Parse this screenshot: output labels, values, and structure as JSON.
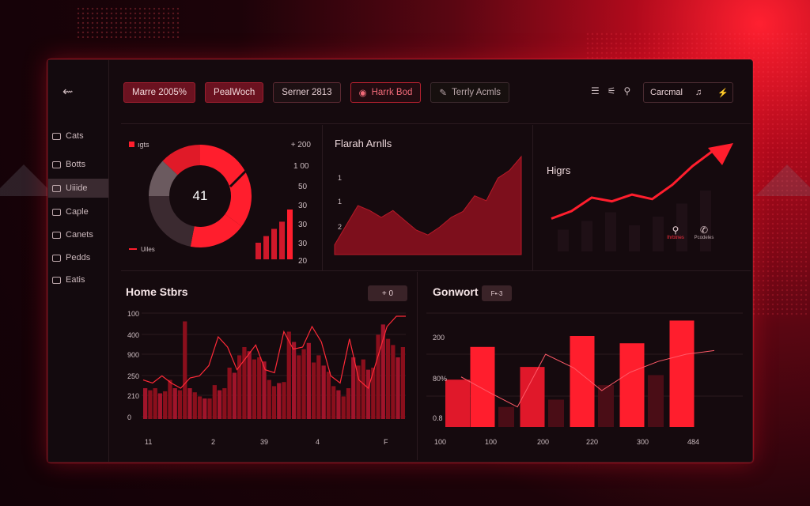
{
  "sidebar": {
    "back_icon": "arrow-left-icon",
    "items": [
      {
        "label": "Cats",
        "icon": "chart-icon"
      },
      {
        "label": "Botts",
        "icon": "wallet-icon"
      },
      {
        "label": "Uiiide",
        "icon": "grid-icon"
      },
      {
        "label": "Caple",
        "icon": "card-icon"
      },
      {
        "label": "Canets",
        "icon": "users-icon"
      },
      {
        "label": "Pedds",
        "icon": "folder-icon"
      },
      {
        "label": "Eatis",
        "icon": "list-icon"
      }
    ]
  },
  "topbar": {
    "buttons": [
      {
        "label": "Marre 2005%",
        "style": "red"
      },
      {
        "label": "PealWoch",
        "style": "red"
      },
      {
        "label": "Serner 2813",
        "style": "dark"
      },
      {
        "label": "Harrk Bod",
        "style": "outline",
        "icon": "eye-icon"
      },
      {
        "label": "Terrly Acmls",
        "style": "ghost",
        "icon": "pen-icon"
      }
    ],
    "tools": [
      "menu-icon",
      "filter-icon",
      "search-icon"
    ],
    "account": {
      "label": "Carcmal",
      "icon1": "bell-icon",
      "icon2": "bolt-icon"
    }
  },
  "colors": {
    "accent": "#ff1e2d",
    "dark_red": "#8a0f1c",
    "gray": "#6b5a5f",
    "bg": "#150a0e"
  },
  "panels": {
    "donut": {
      "legend_top": "ıgts",
      "legend_bottom": "Uiles",
      "center_value": "41",
      "top_right": "+ 200",
      "ticks": [
        "1 00",
        "50",
        "30",
        "30",
        "30",
        "20"
      ],
      "segments": [
        {
          "value": 35,
          "color": "#ff1e2d"
        },
        {
          "value": 18,
          "color": "#ff1e2d"
        },
        {
          "value": 22,
          "color": "#3b2a30"
        },
        {
          "value": 12,
          "color": "#6b5a5f"
        },
        {
          "value": 13,
          "color": "#e01a28"
        }
      ],
      "mini_bars": [
        0.3,
        0.42,
        0.55,
        0.68,
        0.9
      ]
    },
    "area": {
      "title": "Flarah Arnlls",
      "ticks": [
        "1",
        "1",
        "2"
      ],
      "values": [
        0.1,
        0.3,
        0.5,
        0.45,
        0.38,
        0.45,
        0.35,
        0.25,
        0.2,
        0.28,
        0.38,
        0.44,
        0.6,
        0.55,
        0.78,
        0.86,
        1.0
      ]
    },
    "trend": {
      "title": "Higrs",
      "values": [
        0.1,
        0.2,
        0.38,
        0.33,
        0.42,
        0.36,
        0.55,
        0.8,
        1.0
      ],
      "bg_bars": [
        0.25,
        0.35,
        0.45,
        0.3,
        0.4,
        0.55,
        0.7
      ],
      "action1": {
        "icon": "search-icon",
        "label": "Ihrbtnes"
      },
      "action2": {
        "icon": "message-icon",
        "label": "Pcodeles"
      }
    }
  },
  "home_stats": {
    "title": "Home Stbrs",
    "badge": "+ 0",
    "y_ticks": [
      "100",
      "400",
      "900",
      "250",
      "210",
      "0"
    ],
    "x_ticks": [
      "11",
      "2",
      "39",
      "4",
      "",
      "F"
    ],
    "bars": [
      0.3,
      0.28,
      0.3,
      0.25,
      0.27,
      0.38,
      0.3,
      0.28,
      0.95,
      0.3,
      0.26,
      0.22,
      0.2,
      0.2,
      0.33,
      0.28,
      0.3,
      0.5,
      0.45,
      0.62,
      0.7,
      0.66,
      0.58,
      0.6,
      0.56,
      0.38,
      0.32,
      0.35,
      0.36,
      0.85,
      0.75,
      0.62,
      0.68,
      0.74,
      0.55,
      0.62,
      0.52,
      0.46,
      0.32,
      0.28,
      0.22,
      0.3,
      0.6,
      0.52,
      0.58,
      0.48,
      0.5,
      0.82,
      0.92,
      0.78,
      0.72,
      0.6,
      0.7
    ],
    "line": [
      0.38,
      0.35,
      0.42,
      0.35,
      0.3,
      0.4,
      0.42,
      0.52,
      0.8,
      0.7,
      0.48,
      0.6,
      0.72,
      0.48,
      0.45,
      0.85,
      0.68,
      0.7,
      0.9,
      0.75,
      0.42,
      0.35,
      0.78,
      0.38,
      0.3,
      0.6,
      0.9,
      1.0,
      1.0
    ]
  },
  "convert": {
    "title": "Gonwort",
    "badge": "F•-3",
    "y_ticks": [
      "200",
      "80%",
      "0.8"
    ],
    "x_ticks": [
      "100",
      "100",
      "200",
      "220",
      "300",
      "484"
    ],
    "bars": [
      {
        "value": 0.52,
        "color": "#e0182a"
      },
      {
        "value": 0.88,
        "color": "#ff1e2d"
      },
      {
        "value": 0.22,
        "color": "#4a0d16"
      },
      {
        "value": 0.66,
        "color": "#e0182a"
      },
      {
        "value": 0.3,
        "color": "#4a0d16"
      },
      {
        "value": 1.0,
        "color": "#ff1e2d"
      },
      {
        "value": 0.46,
        "color": "#4a0d16"
      },
      {
        "value": 0.92,
        "color": "#ff1e2d"
      },
      {
        "value": 0.57,
        "color": "#4a0d16"
      },
      {
        "value": 1.17,
        "color": "#ff1e2d"
      }
    ],
    "line": [
      0.55,
      0.38,
      0.22,
      0.8,
      0.65,
      0.4,
      0.6,
      0.72,
      0.8,
      0.84
    ]
  }
}
